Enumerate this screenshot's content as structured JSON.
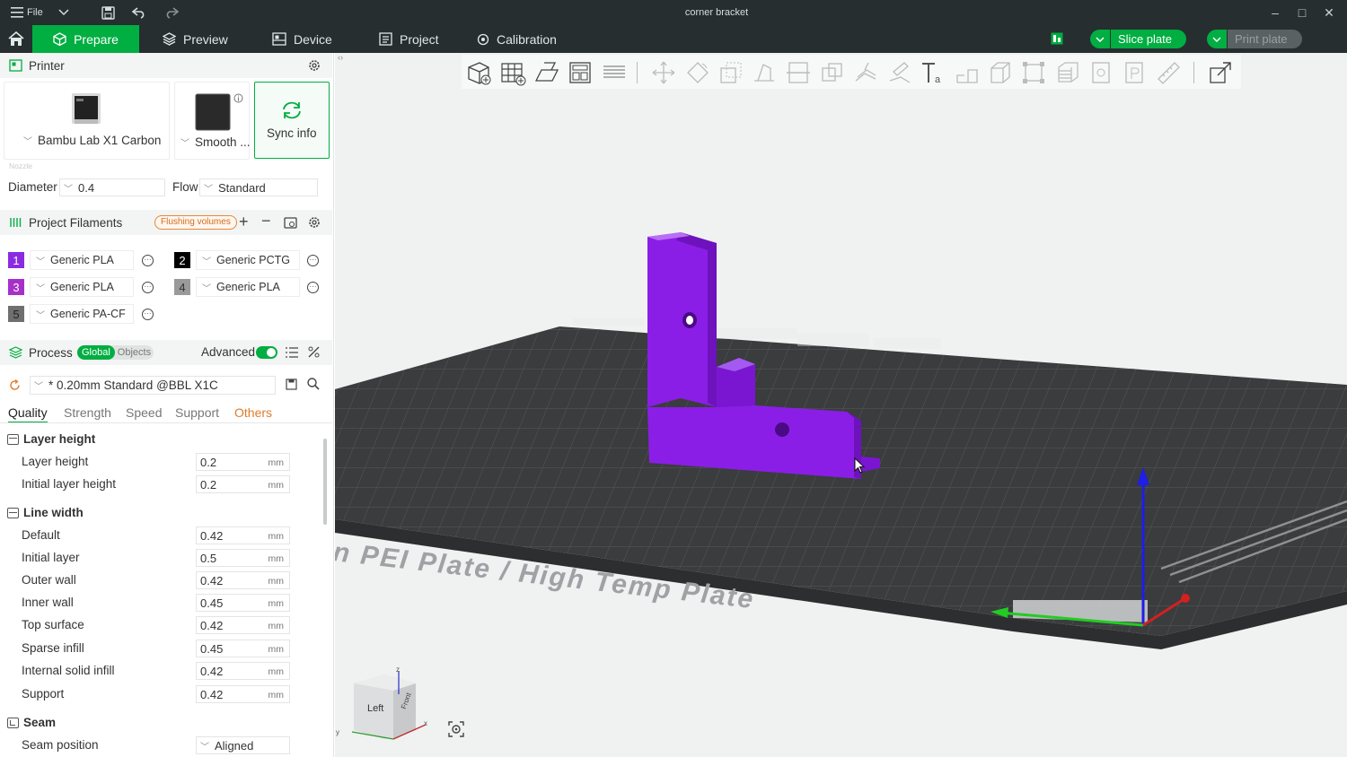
{
  "titlebar": {
    "file_label": "File",
    "title": "corner bracket",
    "minimize": "–",
    "maximize": "□",
    "close": "✕"
  },
  "tabs": [
    {
      "label": "Prepare"
    },
    {
      "label": "Preview"
    },
    {
      "label": "Device"
    },
    {
      "label": "Project"
    },
    {
      "label": "Calibration"
    }
  ],
  "actions": {
    "slice": "Slice plate",
    "print": "Print plate"
  },
  "printer": {
    "section_title": "Printer",
    "name": "Bambu Lab X1 Carbon",
    "plate": "Smooth ...",
    "sync": "Sync info",
    "nozzle_label": "Nozzle",
    "diameter_label": "Diameter",
    "diameter_value": "0.4",
    "flow_label": "Flow",
    "flow_value": "Standard"
  },
  "filaments": {
    "section_title": "Project Filaments",
    "flushing": "Flushing volumes",
    "items": [
      {
        "num": "1",
        "name": "Generic PLA",
        "color": "#8a2be2"
      },
      {
        "num": "2",
        "name": "Generic PCTG",
        "color": "#000000"
      },
      {
        "num": "3",
        "name": "Generic PLA",
        "color": "#a630c8"
      },
      {
        "num": "4",
        "name": "Generic PLA",
        "color": "#9a9a9a"
      },
      {
        "num": "5",
        "name": "Generic PA-CF",
        "color": "#6f6f6f"
      }
    ]
  },
  "process": {
    "section_title": "Process",
    "global": "Global",
    "objects": "Objects",
    "advanced": "Advanced",
    "preset": "* 0.20mm Standard @BBL X1C",
    "tabs": [
      "Quality",
      "Strength",
      "Speed",
      "Support",
      "Others"
    ],
    "groups": {
      "layer_height": {
        "title": "Layer height",
        "rows": [
          {
            "label": "Layer height",
            "value": "0.2",
            "unit": "mm"
          },
          {
            "label": "Initial layer height",
            "value": "0.2",
            "unit": "mm"
          }
        ]
      },
      "line_width": {
        "title": "Line width",
        "rows": [
          {
            "label": "Default",
            "value": "0.42",
            "unit": "mm"
          },
          {
            "label": "Initial layer",
            "value": "0.5",
            "unit": "mm"
          },
          {
            "label": "Outer wall",
            "value": "0.42",
            "unit": "mm"
          },
          {
            "label": "Inner wall",
            "value": "0.45",
            "unit": "mm"
          },
          {
            "label": "Top surface",
            "value": "0.42",
            "unit": "mm"
          },
          {
            "label": "Sparse infill",
            "value": "0.45",
            "unit": "mm"
          },
          {
            "label": "Internal solid infill",
            "value": "0.42",
            "unit": "mm"
          },
          {
            "label": "Support",
            "value": "0.42",
            "unit": "mm"
          }
        ]
      },
      "seam": {
        "title": "Seam",
        "rows": [
          {
            "label": "Seam position",
            "value": "Aligned"
          }
        ]
      }
    }
  },
  "viewport": {
    "plate_text": "n PEI Plate / High Temp Plate",
    "cube_left": "Left",
    "cube_front": "Front",
    "axis_z": "z",
    "axis_x": "x",
    "axis_y": "y"
  },
  "colors": {
    "brand_green": "#00ae42",
    "dark_bar": "#262e30",
    "model_purple": "#8b1ee6",
    "accent_orange": "#e07b2a"
  }
}
